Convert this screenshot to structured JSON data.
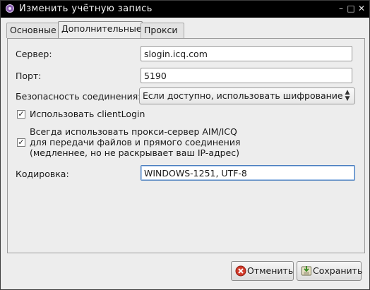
{
  "window": {
    "title": "Изменить учётную запись"
  },
  "tabs": [
    {
      "label": "Основные",
      "active": false
    },
    {
      "label": "Дополнительные",
      "active": true
    },
    {
      "label": "Прокси",
      "active": false
    }
  ],
  "form": {
    "server_label": "Сервер:",
    "server_value": "slogin.icq.com",
    "port_label": "Порт:",
    "port_value": "5190",
    "security_label": "Безопасность соединения:",
    "security_value": "Если доступно, использовать шифрование",
    "clientlogin_label": "Использовать clientLogin",
    "clientlogin_checked": true,
    "proxy_label_1": "Всегда использовать прокси-сервер AIM/ICQ",
    "proxy_label_2": "для передачи файлов и прямого соединения",
    "proxy_label_3": "(медленнее, но не раскрывает ваш IP-адрес)",
    "proxy_checked": true,
    "encoding_label": "Кодировка:",
    "encoding_value": "WINDOWS-1251, UTF-8"
  },
  "buttons": {
    "cancel": "Отменить",
    "save": "Сохранить"
  },
  "colors": {
    "titlebar_bg": "#000000",
    "cancel_icon": "#d23a2a",
    "save_icon": "#3f8f2a"
  }
}
